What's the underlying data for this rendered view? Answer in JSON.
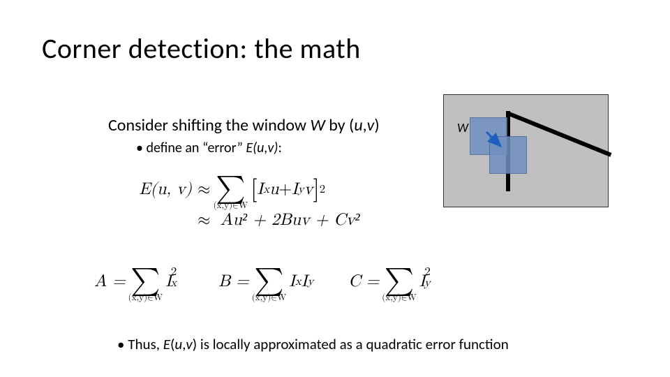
{
  "title": "Corner detection:  the math",
  "subhead_pre": "Consider shifting the window ",
  "subhead_W": "W",
  "subhead_mid": " by (",
  "subhead_u": "u",
  "subhead_comma": ",",
  "subhead_v": "v",
  "subhead_post": ")",
  "bullet1_pre": "• define an “error” ",
  "bullet1_E": "E(u,v)",
  "bullet1_post": ":",
  "fig_label": "W",
  "eq1_lhs": "E(u, v)",
  "eq_approx": "≈",
  "sum_under": "(x,y)∈W",
  "eq1_rhs_open": "[",
  "eq1_Ix": "I",
  "eq1_Ix_sub": "x",
  "eq1_u": "u",
  "eq1_plus": " + ",
  "eq1_Iy": "I",
  "eq1_Iy_sub": "y",
  "eq1_v": "v",
  "eq1_rhs_close": "]",
  "eq1_sq": "2",
  "eq2_rhs": "Au² + 2Buv + Cv²",
  "A_lhs": "A =",
  "A_term": "I",
  "A_sub": "x",
  "A_sq": "2",
  "B_lhs": "B =",
  "B_term1": "I",
  "B_sub1": "x",
  "B_term2": "I",
  "B_sub2": "y",
  "C_lhs": "C =",
  "C_term": "I",
  "C_sub": "y",
  "C_sq": "2",
  "bullet2_pre": "• Thus, ",
  "bullet2_E": "E",
  "bullet2_paren_open": "(",
  "bullet2_u": "u",
  "bullet2_comma": ",",
  "bullet2_v": "v",
  "bullet2_paren_close": ")",
  "bullet2_post": " is locally approximated as a quadratic error function"
}
